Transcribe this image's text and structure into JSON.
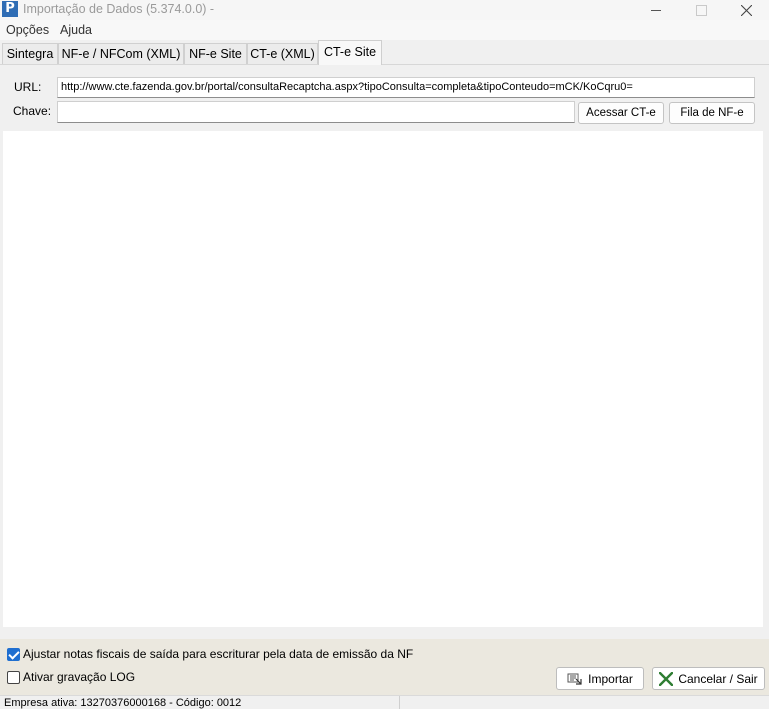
{
  "window": {
    "logo_letter": "P",
    "title": "Importação de Dados (5.374.0.0) -"
  },
  "menu": {
    "options": "Opções",
    "help": "Ajuda"
  },
  "tabs": [
    "Sintegra",
    "NF-e / NFCom (XML)",
    "NF-e Site",
    "CT-e (XML)",
    "CT-e Site"
  ],
  "active_tab": "CT-e Site",
  "form": {
    "url_label": "URL:",
    "url_value": "http://www.cte.fazenda.gov.br/portal/consultaRecaptcha.aspx?tipoConsulta=completa&tipoConteudo=mCK/KoCqru0=",
    "key_label": "Chave:",
    "key_value": "",
    "access_button": "Acessar CT-e",
    "queue_button": "Fila de NF-e"
  },
  "options": {
    "adjust_label": "Ajustar notas fiscais de saída para escriturar pela data de emissão da NF",
    "adjust_checked": true,
    "log_label": "Ativar gravação LOG",
    "log_checked": false
  },
  "actions": {
    "import": "Importar",
    "cancel": "Cancelar / Sair"
  },
  "status": {
    "text": "Empresa ativa: 13270376000168 - Código: 0012"
  },
  "colors": {
    "accent": "#1f6fd0",
    "logo": "#2f6db5",
    "cancel_icon": "#2e7d32",
    "bottom_bar": "#ebe8df"
  }
}
